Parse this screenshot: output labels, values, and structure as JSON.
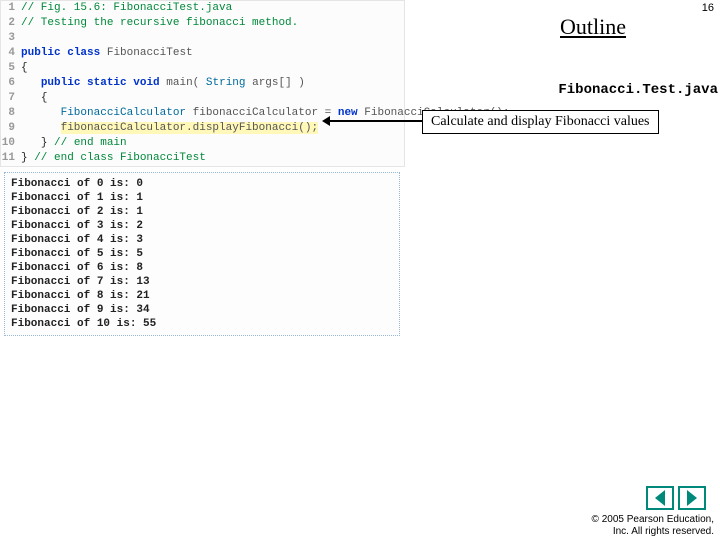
{
  "page_number": "16",
  "outline": "Outline",
  "filename": "Fibonacci.Test.java",
  "callout": "Calculate and display Fibonacci values",
  "copyright_line1": "© 2005 Pearson Education,",
  "copyright_line2": "Inc.  All rights reserved.",
  "code": {
    "l1": {
      "n": "1",
      "comment": "// Fig. 15.6: FibonacciTest.java"
    },
    "l2": {
      "n": "2",
      "comment": "// Testing the recursive fibonacci method."
    },
    "l3": {
      "n": "3"
    },
    "l4": {
      "n": "4",
      "kw1": "public",
      "kw2": "class",
      "name": "FibonacciTest"
    },
    "l5": {
      "n": "5",
      "brace": "{"
    },
    "l6": {
      "n": "6",
      "kw1": "public",
      "kw2": "static",
      "kw3": "void",
      "name": "main(",
      "type": "String",
      "rest": " args[] )"
    },
    "l7": {
      "n": "7",
      "brace": "{"
    },
    "l8": {
      "n": "8",
      "type": "FibonacciCalculator",
      "var": " fibonacciCalculator = ",
      "kw": "new",
      "ctor": " FibonacciCalculator();",
      "tail": ""
    },
    "l9": {
      "n": "9",
      "stmt": "fibonacciCalculator.displayFibonacci();"
    },
    "l10": {
      "n": "10",
      "brace": "}",
      "comment": " // end main"
    },
    "l11": {
      "n": "11",
      "brace": "}",
      "comment": " // end class FibonacciTest"
    }
  },
  "output": "Fibonacci of 0 is: 0\nFibonacci of 1 is: 1\nFibonacci of 2 is: 1\nFibonacci of 3 is: 2\nFibonacci of 4 is: 3\nFibonacci of 5 is: 5\nFibonacci of 6 is: 8\nFibonacci of 7 is: 13\nFibonacci of 8 is: 21\nFibonacci of 9 is: 34\nFibonacci of 10 is: 55"
}
